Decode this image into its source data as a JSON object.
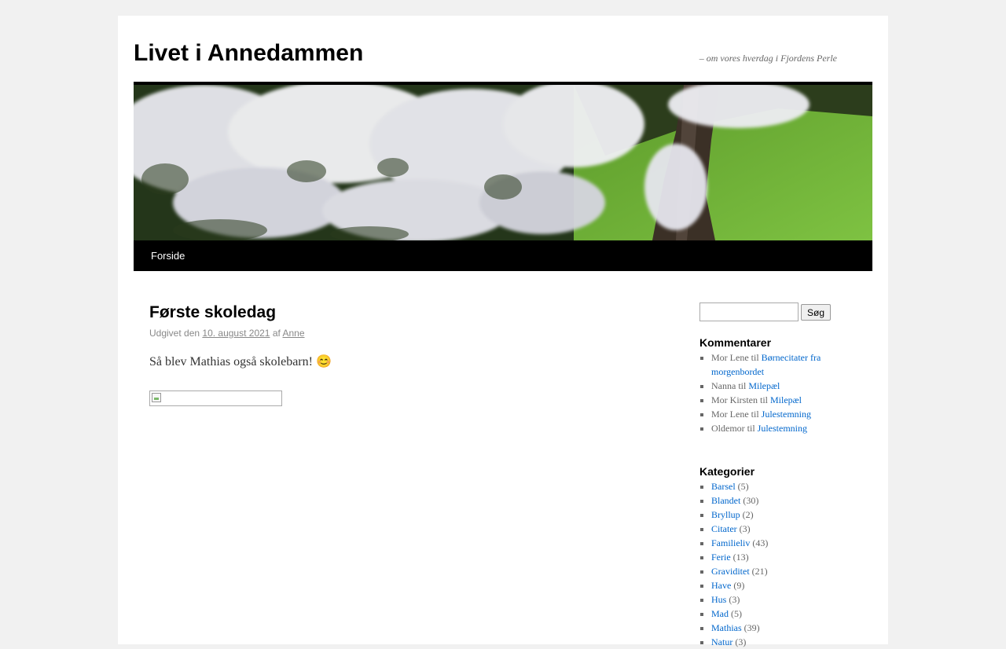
{
  "site": {
    "title": "Livet i Annedammen",
    "description": "– om vores hverdag i Fjordens Perle"
  },
  "nav": {
    "items": [
      {
        "label": "Forside"
      }
    ]
  },
  "post": {
    "title": "Første skoledag",
    "meta_prefix": "Udgivet den",
    "date": "10. august 2021",
    "meta_by": "af",
    "author": "Anne",
    "content": "Så blev Mathias også skolebarn! 😊"
  },
  "sidebar": {
    "search": {
      "button_label": "Søg",
      "value": ""
    },
    "comments": {
      "title": "Kommentarer",
      "items": [
        {
          "author": "Mor Lene",
          "connector": "til",
          "post": "Børnecitater fra morgenbordet"
        },
        {
          "author": "Nanna",
          "connector": "til",
          "post": "Milepæl"
        },
        {
          "author": "Mor Kirsten",
          "connector": "til",
          "post": "Milepæl"
        },
        {
          "author": "Mor Lene",
          "connector": "til",
          "post": "Julestemning"
        },
        {
          "author": "Oldemor",
          "connector": "til",
          "post": "Julestemning"
        }
      ]
    },
    "categories": {
      "title": "Kategorier",
      "items": [
        {
          "name": "Barsel",
          "count": "(5)"
        },
        {
          "name": "Blandet",
          "count": "(30)"
        },
        {
          "name": "Bryllup",
          "count": "(2)"
        },
        {
          "name": "Citater",
          "count": "(3)"
        },
        {
          "name": "Familieliv",
          "count": "(43)"
        },
        {
          "name": "Ferie",
          "count": "(13)"
        },
        {
          "name": "Graviditet",
          "count": "(21)"
        },
        {
          "name": "Have",
          "count": "(9)"
        },
        {
          "name": "Hus",
          "count": "(3)"
        },
        {
          "name": "Mad",
          "count": "(5)"
        },
        {
          "name": "Mathias",
          "count": "(39)"
        },
        {
          "name": "Natur",
          "count": "(3)"
        }
      ]
    }
  },
  "colors": {
    "link": "#0066cc",
    "nav_bg": "#000000",
    "page_bg": "#f1f1f1"
  }
}
